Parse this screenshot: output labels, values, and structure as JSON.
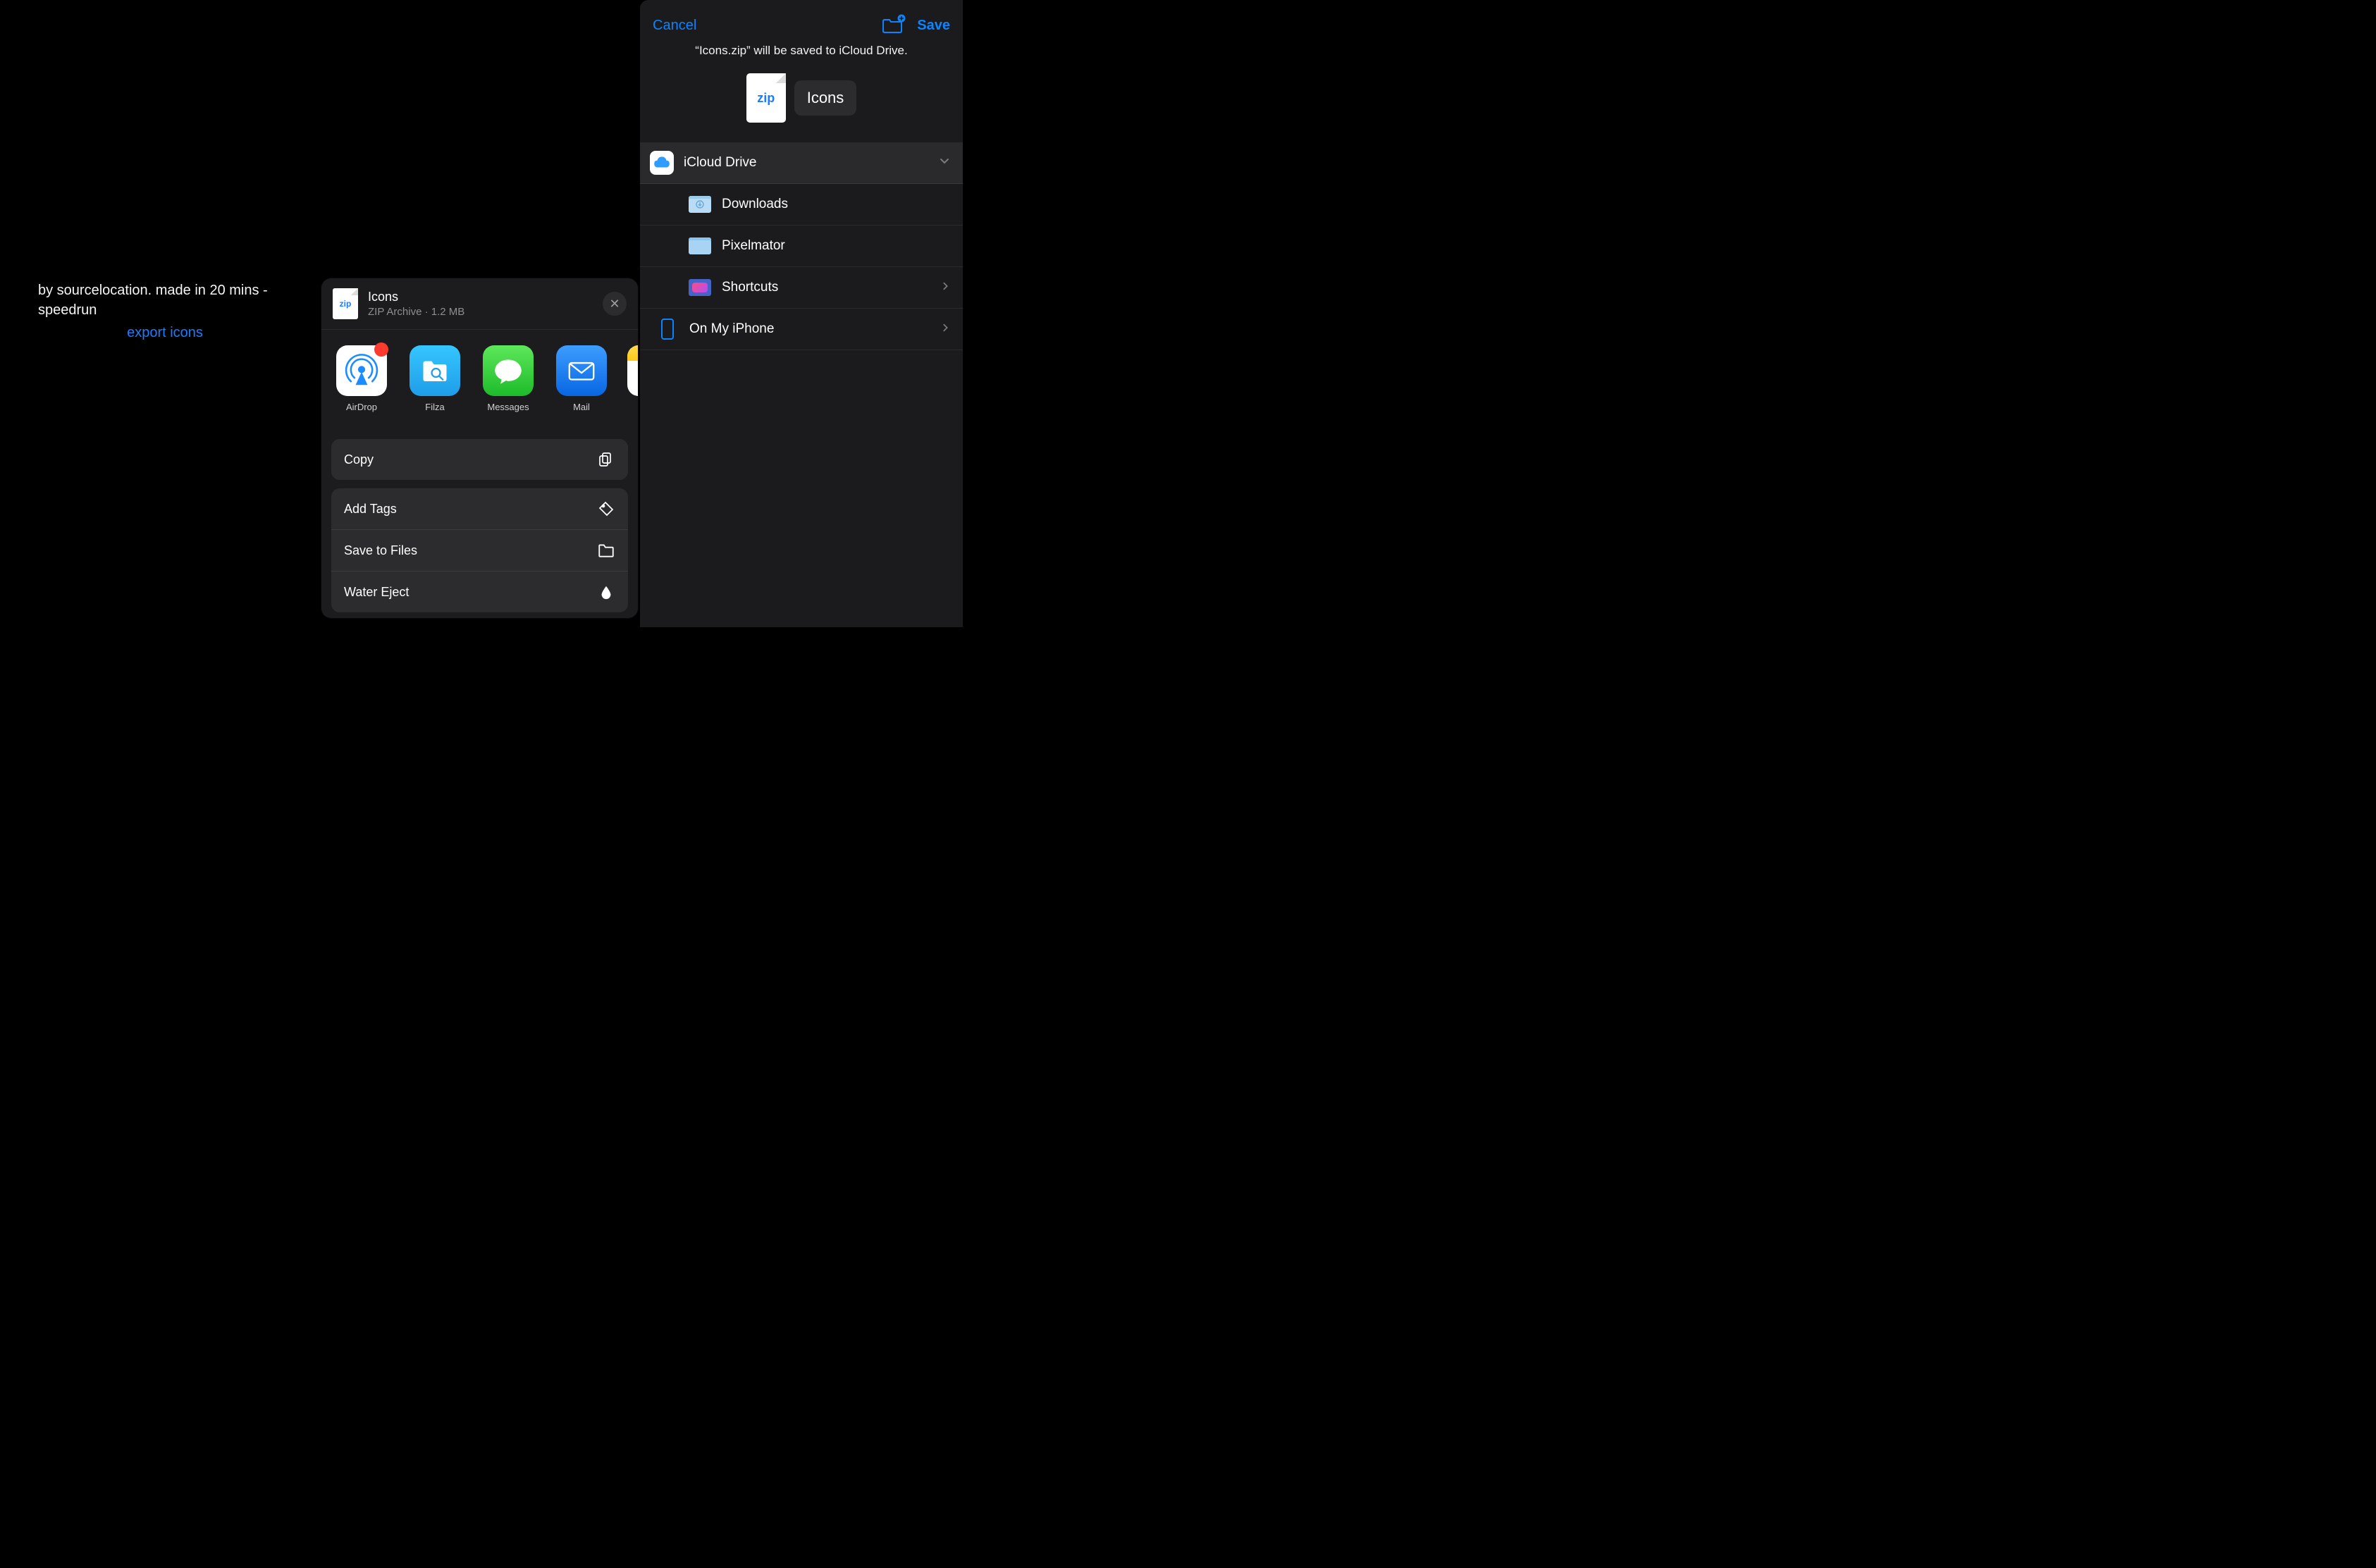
{
  "left": {
    "credit": "by sourcelocation. made in 20 mins - speedrun",
    "export": "export icons"
  },
  "share": {
    "file_name": "Icons",
    "file_meta": "ZIP Archive · 1.2 MB",
    "thumb_label": "zip",
    "apps": [
      {
        "id": "airdrop",
        "label": "AirDrop",
        "badge": true
      },
      {
        "id": "filza",
        "label": "Filza"
      },
      {
        "id": "messages",
        "label": "Messages"
      },
      {
        "id": "mail",
        "label": "Mail"
      },
      {
        "id": "notes",
        "label": ""
      }
    ],
    "actions_primary": [
      {
        "id": "copy",
        "label": "Copy",
        "icon": "copy"
      }
    ],
    "actions_secondary": [
      {
        "id": "add-tags",
        "label": "Add Tags",
        "icon": "tag"
      },
      {
        "id": "save-files",
        "label": "Save to Files",
        "icon": "folder"
      },
      {
        "id": "water-eject",
        "label": "Water Eject",
        "icon": "drop"
      }
    ]
  },
  "save": {
    "cancel": "Cancel",
    "save": "Save",
    "blurb": "“Icons.zip” will be saved to iCloud Drive.",
    "thumb_label": "zip",
    "filename": "Icons",
    "locations": {
      "root": {
        "label": "iCloud Drive"
      },
      "downloads": {
        "label": "Downloads"
      },
      "pixelmator": {
        "label": "Pixelmator"
      },
      "shortcuts": {
        "label": "Shortcuts"
      },
      "on_iphone": {
        "label": "On My iPhone"
      }
    }
  }
}
